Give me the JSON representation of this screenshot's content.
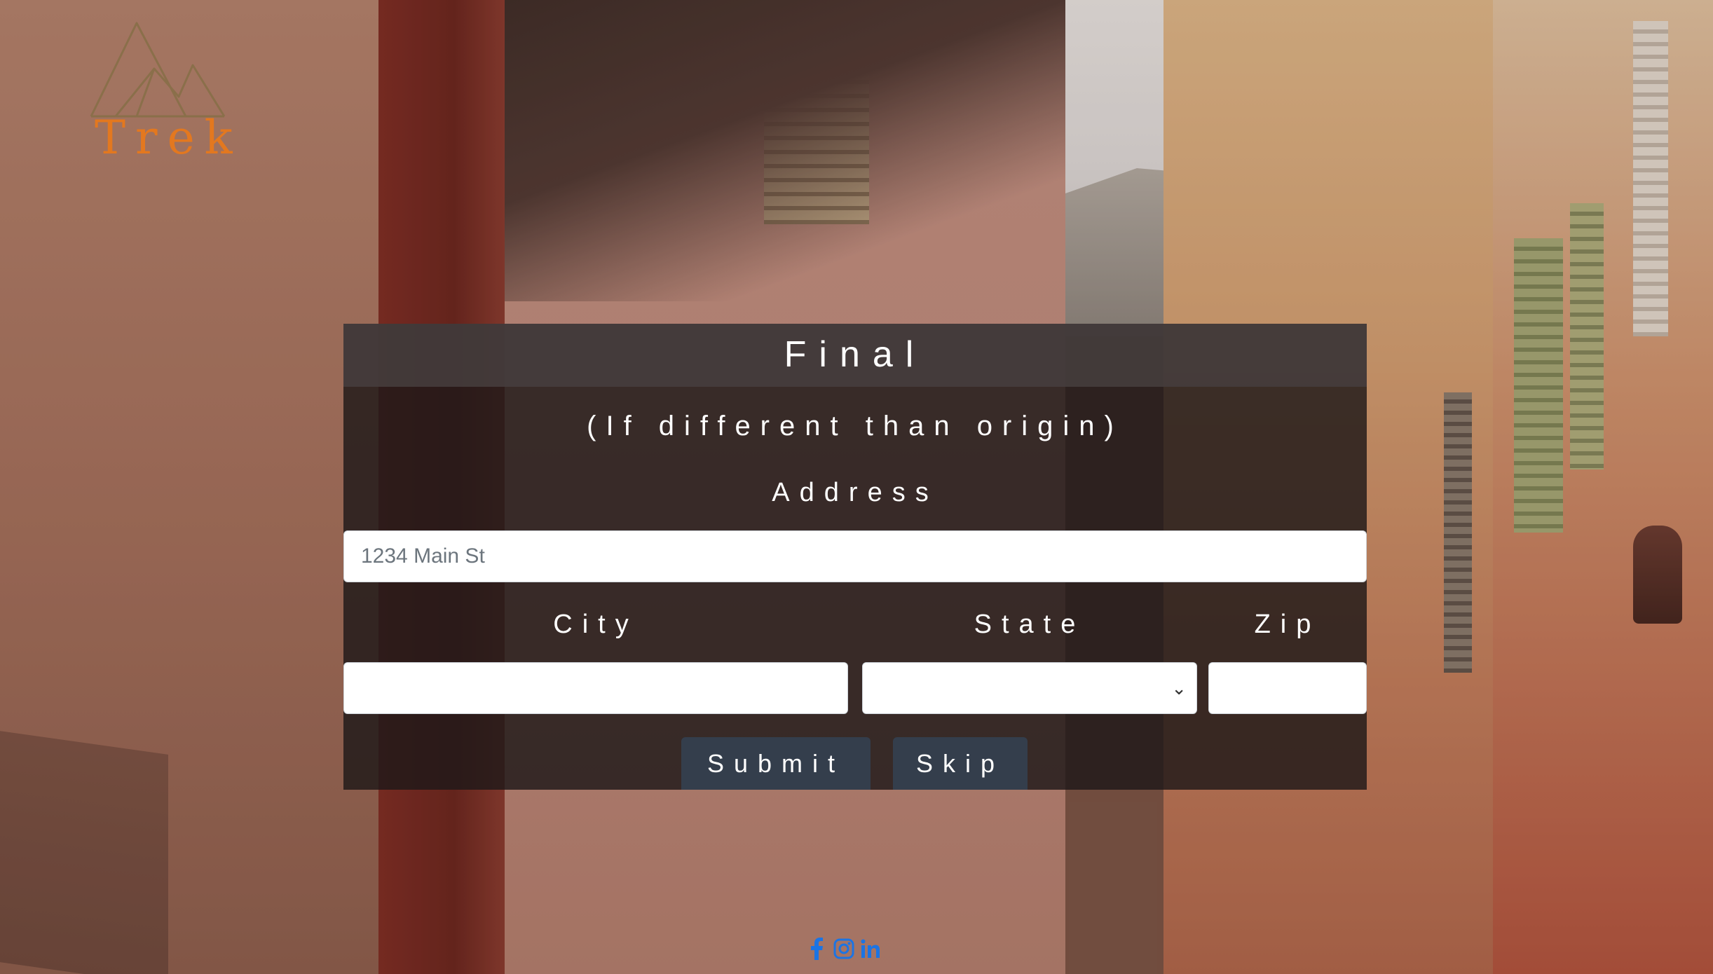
{
  "brand": {
    "name": "Trek",
    "accent_color": "#e3781f",
    "logo_icon": "mountain-icon"
  },
  "form": {
    "title": "Final",
    "subtitle": "(If different than origin)",
    "address_label": "Address",
    "address_placeholder": "1234 Main St",
    "city_label": "City",
    "city_value": "",
    "state_label": "State",
    "state_selected": "",
    "zip_label": "Zip",
    "zip_value": "",
    "submit_label": "Submit",
    "skip_label": "Skip"
  },
  "footer": {
    "social_icons": [
      "facebook-icon",
      "instagram-icon",
      "linkedin-icon"
    ],
    "icon_color": "#1b74e4"
  }
}
